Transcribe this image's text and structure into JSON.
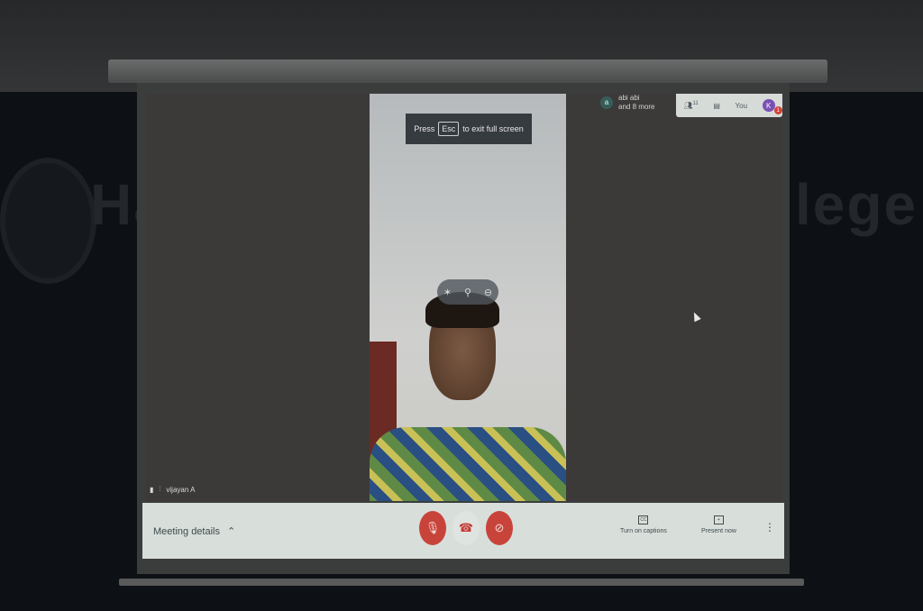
{
  "toast": {
    "press": "Press",
    "key": "Esc",
    "suffix": "to exit full screen"
  },
  "participants": {
    "avatar": "a",
    "name_line": "abi abi",
    "more": "and 8 more"
  },
  "top_bar": {
    "people_count": "11",
    "you_label": "You",
    "you_initial": "K",
    "you_badge": "1"
  },
  "tile_label": {
    "name": "vijayan A"
  },
  "bottom_bar": {
    "meeting_details": "Meeting details",
    "captions_label": "Turn on captions",
    "captions_icon_text": "CC",
    "present_label": "Present now"
  },
  "wall": {
    "left_text": "Ha",
    "right_text": "lege"
  },
  "icons": {
    "mic_off": "mic-off-icon",
    "end_call": "end-call-icon",
    "cam_off": "camera-off-icon",
    "people": "people-icon",
    "chat": "chat-icon",
    "more": "more-vert-icon"
  }
}
